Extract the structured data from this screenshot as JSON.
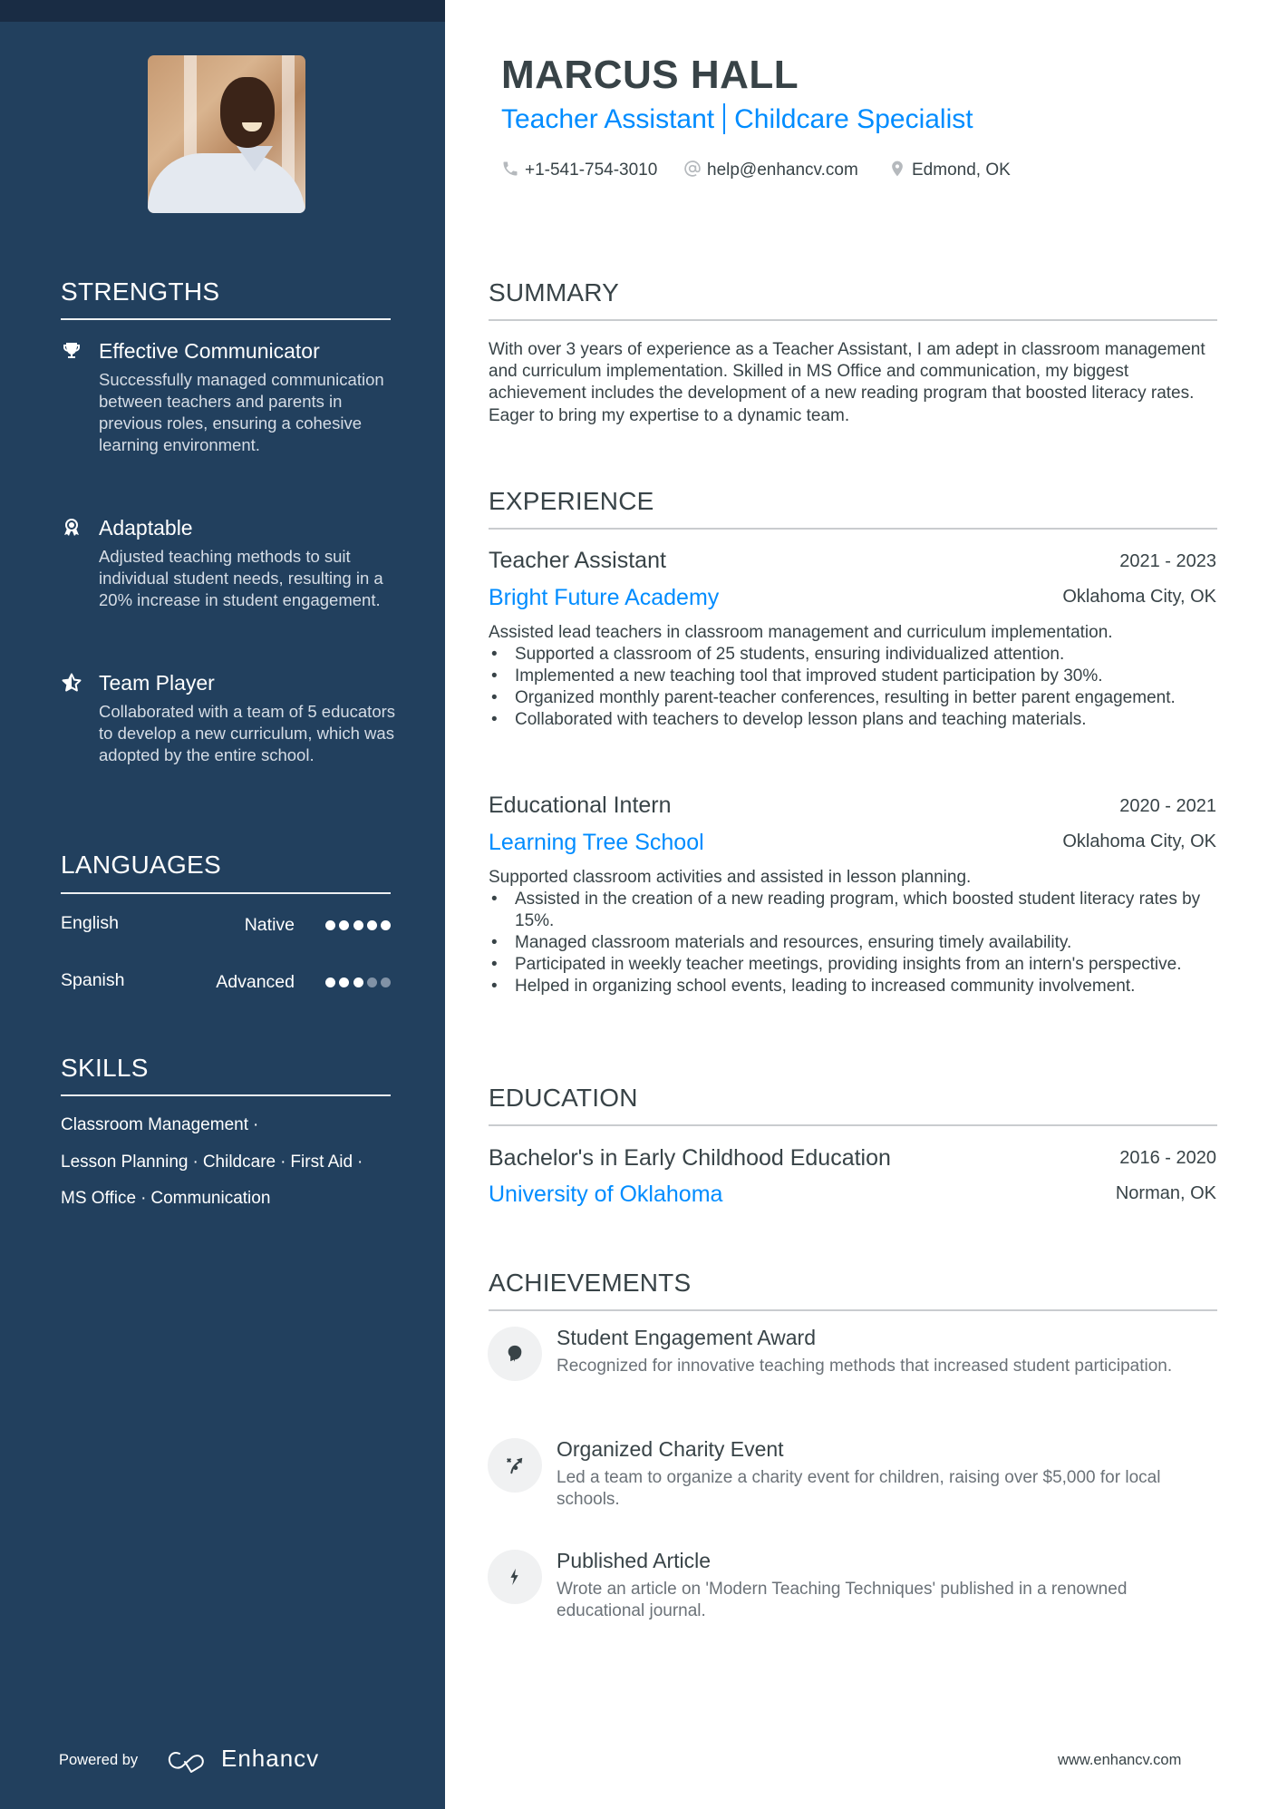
{
  "header": {
    "name": "MARCUS HALL",
    "title_left": "Teacher Assistant",
    "title_right": "Childcare Specialist",
    "contacts": [
      {
        "icon": "phone-icon",
        "text": "+1-541-754-3010"
      },
      {
        "icon": "at-sign-icon",
        "text": "help@enhancv.com"
      },
      {
        "icon": "location-pin-icon",
        "text": "Edmond, OK"
      }
    ]
  },
  "sidebar": {
    "photo_alt": "Profile photo of Marcus Hall",
    "strengths": {
      "heading": "STRENGTHS",
      "items": [
        {
          "icon": "trophy-icon",
          "title": "Effective Communicator",
          "description": "Successfully managed communication between teachers and parents in previous roles, ensuring a cohesive learning environment."
        },
        {
          "icon": "medal-icon",
          "title": "Adaptable",
          "description": "Adjusted teaching methods to suit individual student needs, resulting in a 20% increase in student engagement."
        },
        {
          "icon": "star-icon",
          "title": "Team Player",
          "description": "Collaborated with a team of 5 educators to develop a new curriculum, which was adopted by the entire school."
        }
      ]
    },
    "languages": {
      "heading": "LANGUAGES",
      "items": [
        {
          "name": "English",
          "level": "Native",
          "rating": 5,
          "max": 5
        },
        {
          "name": "Spanish",
          "level": "Advanced",
          "rating": 3,
          "max": 5
        }
      ]
    },
    "skills": {
      "heading": "SKILLS",
      "lines": [
        [
          "Classroom Management"
        ],
        [
          "Lesson Planning",
          "Childcare",
          "First Aid"
        ],
        [
          "MS Office",
          "Communication"
        ]
      ],
      "items": [
        "Classroom Management",
        "Lesson Planning",
        "Childcare",
        "First Aid",
        "MS Office",
        "Communication"
      ],
      "separator": "·"
    },
    "footer": {
      "powered_by": "Powered by",
      "brand": "Enhancv"
    }
  },
  "summary": {
    "heading": "SUMMARY",
    "text": "With over 3 years of experience as a Teacher Assistant, I am adept in classroom management and curriculum implementation. Skilled in MS Office and communication, my biggest achievement includes the development of a new reading program that boosted literacy rates. Eager to bring my expertise to a dynamic team."
  },
  "experience": {
    "heading": "EXPERIENCE",
    "items": [
      {
        "role": "Teacher Assistant",
        "dates": "2021 - 2023",
        "company": "Bright Future Academy",
        "location": "Oklahoma City, OK",
        "description": "Assisted lead teachers in classroom management and curriculum implementation.",
        "bullets": [
          "Supported a classroom of 25 students, ensuring individualized attention.",
          "Implemented a new teaching tool that improved student participation by 30%.",
          "Organized monthly parent-teacher conferences, resulting in better parent engagement.",
          "Collaborated with teachers to develop lesson plans and teaching materials."
        ]
      },
      {
        "role": "Educational Intern",
        "dates": "2020 - 2021",
        "company": "Learning Tree School",
        "location": "Oklahoma City, OK",
        "description": "Supported classroom activities and assisted in lesson planning.",
        "bullets": [
          "Assisted in the creation of a new reading program, which boosted student literacy rates by 15%.",
          "Managed classroom materials and resources, ensuring timely availability.",
          "Participated in weekly teacher meetings, providing insights from an intern's perspective.",
          "Helped in organizing school events, leading to increased community involvement."
        ]
      }
    ]
  },
  "education": {
    "heading": "EDUCATION",
    "items": [
      {
        "degree": "Bachelor's in Early Childhood Education",
        "dates": "2016 - 2020",
        "school": "University of Oklahoma",
        "location": "Norman, OK"
      }
    ]
  },
  "achievements": {
    "heading": "ACHIEVEMENTS",
    "items": [
      {
        "icon": "head-lightbulb-icon",
        "title": "Student Engagement Award",
        "description": "Recognized for innovative teaching methods that increased student participation."
      },
      {
        "icon": "strategy-arrow-icon",
        "title": "Organized Charity Event",
        "description": "Led a team to organize a charity event for children, raising over $5,000 for local schools."
      },
      {
        "icon": "lightning-bolt-icon",
        "title": "Published Article",
        "description": "Wrote an article on 'Modern Teaching Techniques' published in a renowned educational journal."
      }
    ]
  },
  "footer": {
    "website": "www.enhancv.com"
  },
  "colors": {
    "sidebar_bg": "#22405e",
    "sidebar_topband": "#192c44",
    "accent": "#008cff",
    "text": "#384347",
    "muted_text": "#6b7278",
    "rule": "#c9cccf"
  }
}
